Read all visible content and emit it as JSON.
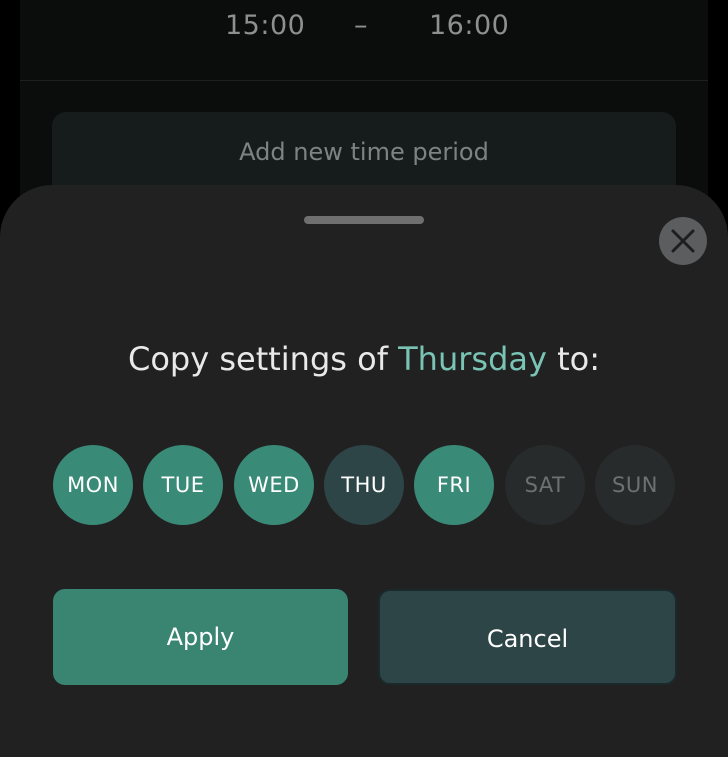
{
  "background": {
    "time_start": "15:00",
    "time_separator": "–",
    "time_end": "16:00",
    "add_period_label": "Add new time period"
  },
  "sheet": {
    "title_prefix": "Copy settings of ",
    "title_day": "Thursday",
    "title_suffix": " to:",
    "close_icon": "close-x-icon",
    "days": [
      {
        "label": "MON",
        "state": "selected"
      },
      {
        "label": "TUE",
        "state": "selected"
      },
      {
        "label": "WED",
        "state": "selected"
      },
      {
        "label": "THU",
        "state": "current"
      },
      {
        "label": "FRI",
        "state": "selected"
      },
      {
        "label": "SAT",
        "state": "unselected"
      },
      {
        "label": "SUN",
        "state": "unselected"
      }
    ],
    "apply_label": "Apply",
    "cancel_label": "Cancel"
  },
  "colors": {
    "accent": "#3a8a78",
    "highlight_text": "#79c4b5",
    "sheet_background": "#212121",
    "secondary_button": "#2e4548"
  }
}
